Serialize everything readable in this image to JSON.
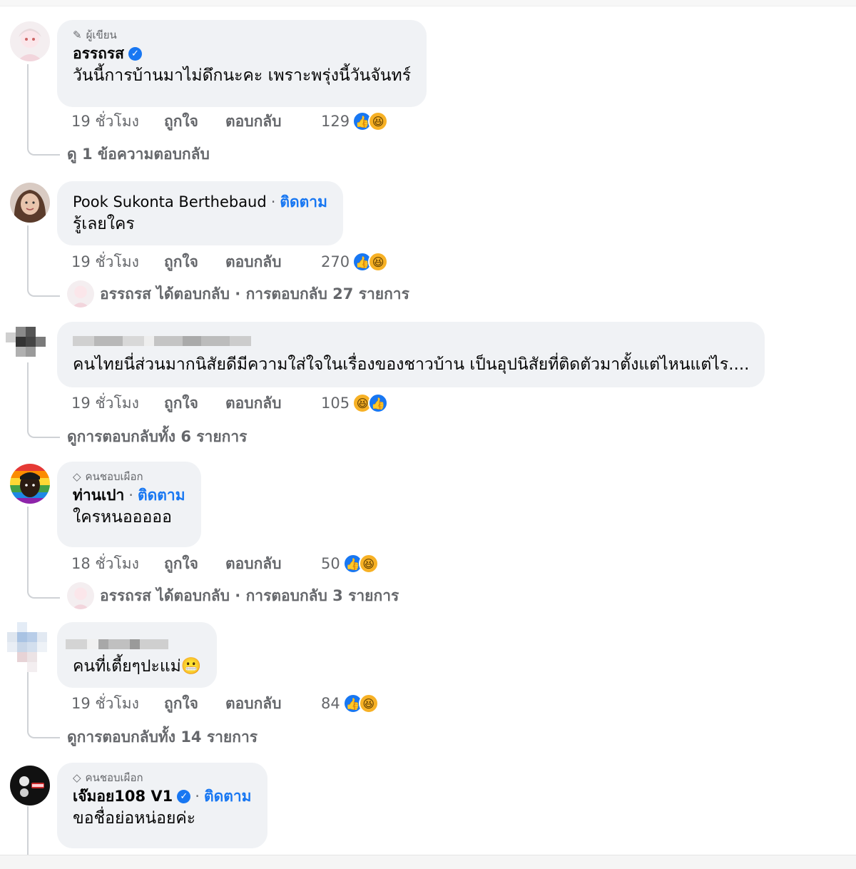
{
  "comments": [
    {
      "badge": "ผู้เขียน",
      "badge_icon": "pencil-icon",
      "name": "อรรถรส",
      "verified": true,
      "follow": "",
      "text": "วันนี้การบ้านมาไม่ดึกนะคะ เพราะพรุ่งนี้วันจันทร์",
      "time": "19 ชั่วโมง",
      "like": "ถูกใจ",
      "reply": "ตอบกลับ",
      "count": "129",
      "reactions": [
        "like",
        "haha"
      ],
      "replies_text": "ดู 1 ข้อความตอบกลับ"
    },
    {
      "badge": "",
      "name": "Pook Sukonta Berthebaud",
      "verified": false,
      "follow": "ติดตาม",
      "text": "รู้เลยใคร",
      "time": "19 ชั่วโมง",
      "like": "ถูกใจ",
      "reply": "ตอบกลับ",
      "count": "270",
      "reactions": [
        "like",
        "haha"
      ],
      "replies_text": "อรรถรส ได้ตอบกลับ · การตอบกลับ 27 รายการ"
    },
    {
      "badge": "",
      "name": "",
      "verified": false,
      "follow": "",
      "text": "คนไทยนี่ส่วนมากนิสัยดีมีความใส่ใจในเรื่องของชาวบ้าน เป็นอุปนิสัยที่ติดตัวมาตั้งแต่ไหนแต่ไร....",
      "time": "19 ชั่วโมง",
      "like": "ถูกใจ",
      "reply": "ตอบกลับ",
      "count": "105",
      "reactions": [
        "haha",
        "like"
      ],
      "replies_text": "ดูการตอบกลับทั้ง 6 รายการ"
    },
    {
      "badge": "คนชอบเผือก",
      "badge_icon": "diamond-icon",
      "name": "ท่านเปา",
      "verified": false,
      "follow": "ติดตาม",
      "text": "ใครหนอออออ",
      "time": "18 ชั่วโมง",
      "like": "ถูกใจ",
      "reply": "ตอบกลับ",
      "count": "50",
      "reactions": [
        "like",
        "haha"
      ],
      "replies_text": "อรรถรส ได้ตอบกลับ · การตอบกลับ 3 รายการ"
    },
    {
      "badge": "",
      "name": "",
      "verified": false,
      "follow": "",
      "text": "คนที่เตี้ยๆปะแม่",
      "emoji": "😬",
      "time": "19 ชั่วโมง",
      "like": "ถูกใจ",
      "reply": "ตอบกลับ",
      "count": "84",
      "reactions": [
        "like",
        "haha"
      ],
      "replies_text": "ดูการตอบกลับทั้ง 14 รายการ"
    },
    {
      "badge": "คนชอบเผือก",
      "badge_icon": "diamond-icon",
      "name": "เจ๊มอย108 V1",
      "verified": true,
      "follow": "ติดตาม",
      "text": "ขอชื่อย่อหน่อยค่ะ"
    }
  ],
  "colors": {
    "accent": "#1877f2",
    "bubble": "#f0f2f5",
    "meta_text": "#65676b",
    "haha": "#f7b125"
  }
}
